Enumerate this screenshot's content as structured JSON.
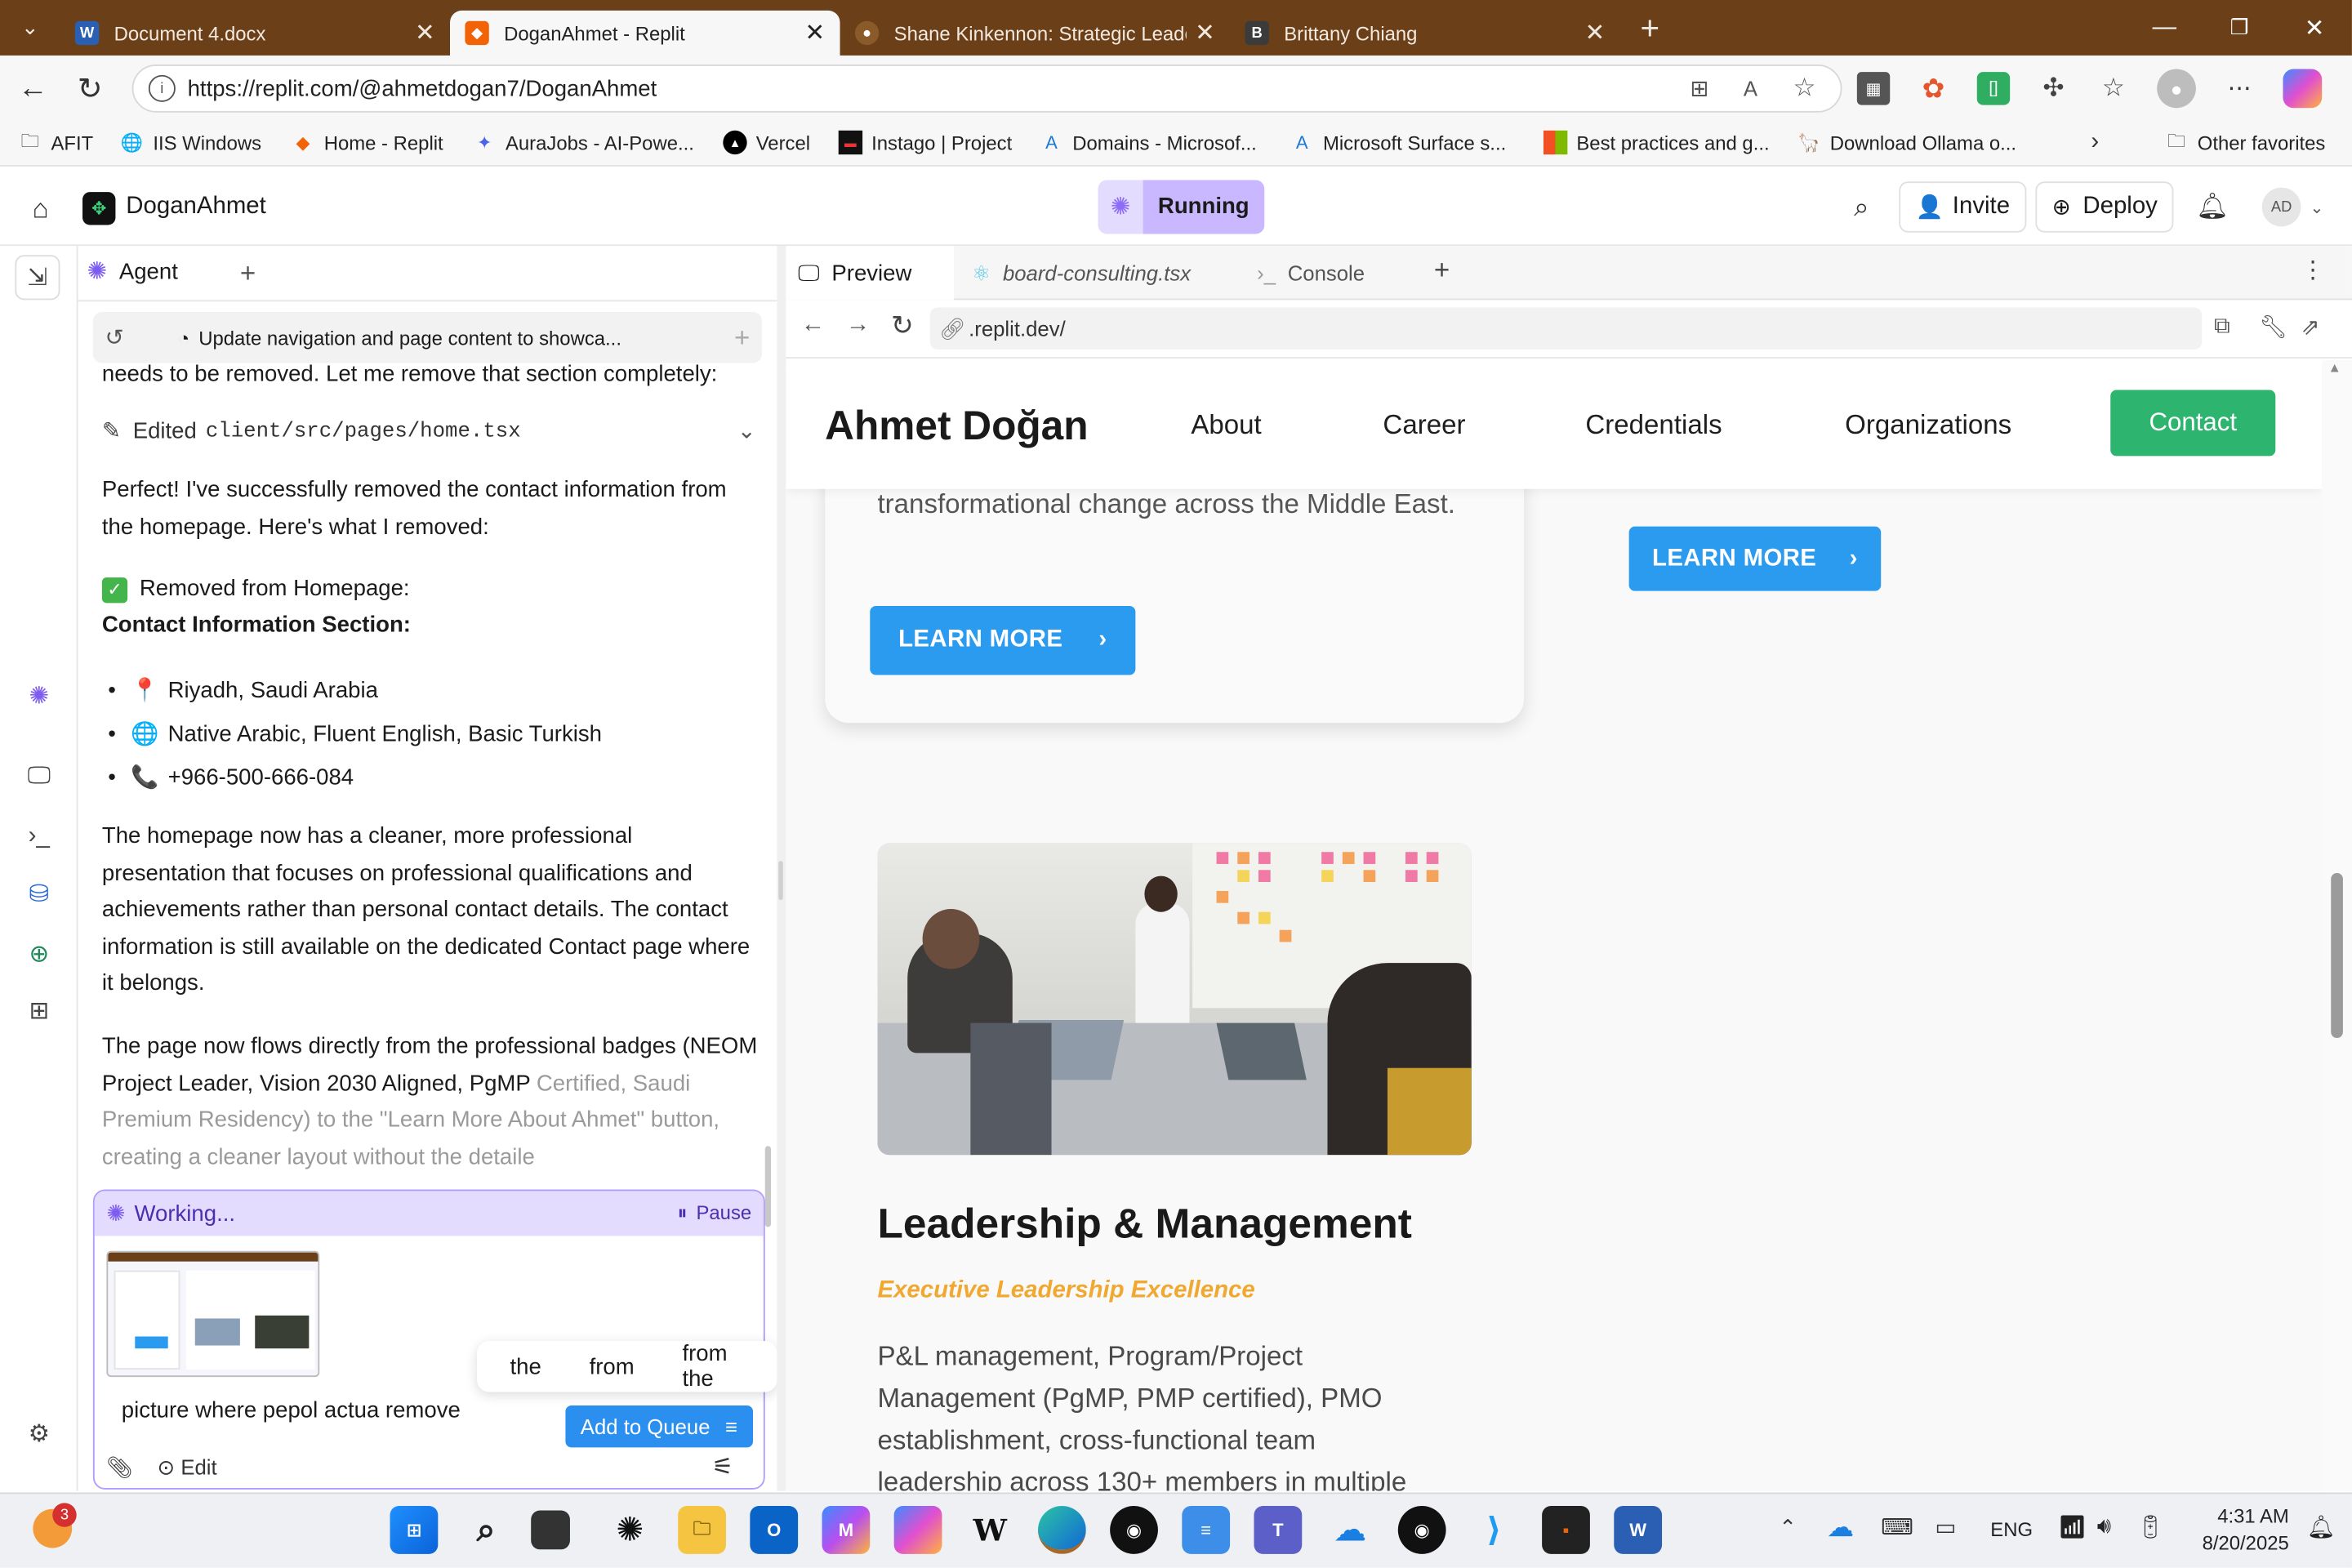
{
  "browser": {
    "tabs": [
      {
        "title": "Document 4.docx",
        "icon": "word-icon"
      },
      {
        "title": "DoganAhmet - Replit",
        "icon": "replit-icon"
      },
      {
        "title": "Shane Kinkennon: Strategic Leade",
        "icon": "site-icon"
      },
      {
        "title": "Brittany Chiang",
        "icon": "b-icon"
      }
    ],
    "url": "https://replit.com/@ahmetdogan7/DoganAhmet",
    "bookmarks": [
      "AFIT",
      "IIS Windows",
      "Home - Replit",
      "AuraJobs - AI-Powe...",
      "Vercel",
      "Instago | Project",
      "Domains - Microsof...",
      "Microsoft Surface s...",
      "Best practices and g...",
      "Download Ollama o..."
    ],
    "other_favorites": "Other favorites"
  },
  "replit": {
    "project_name": "DoganAhmet",
    "status": "Running",
    "invite": "Invite",
    "deploy": "Deploy",
    "avatar": "AD"
  },
  "agent": {
    "tab_label": "Agent",
    "checkpoint": "Update navigation and page content to showca...",
    "intro_line": "needs to be removed. Let me remove that section completely:",
    "edited_label": "Edited",
    "edited_file": "client/src/pages/home.tsx",
    "para1": "Perfect! I've successfully removed the contact information from the homepage. Here's what I removed:",
    "removed_heading": "Removed from Homepage:",
    "section_heading": "Contact Information Section:",
    "bullets": [
      {
        "emoji": "📍",
        "text": "Riyadh, Saudi Arabia"
      },
      {
        "emoji": "🌐",
        "text": "Native Arabic, Fluent English, Basic Turkish"
      },
      {
        "emoji": "📞",
        "text": "+966-500-666-084"
      }
    ],
    "para2": "The homepage now has a cleaner, more professional presentation that focuses on professional qualifications and achievements rather than personal contact details. The contact information is still available on the dedicated Contact page where it belongs.",
    "para3_a": "The page now flows directly from the professional badges (NEOM Project Leader, Vision 2030 Aligned, PgMP ",
    "para3_b": "Certified, Saudi Premium Residency) to the \"Learn More About Ahmet\" button, creating a cleaner layout without the detaile",
    "working": "Working...",
    "pause": "Pause",
    "input_text": "picture where pepol actua remove",
    "suggestions": [
      "the",
      "from",
      "from the"
    ],
    "edit": "Edit",
    "add_to_queue": "Add to Queue"
  },
  "preview": {
    "tabs": [
      "Preview",
      "board-consulting.tsx",
      "Console"
    ],
    "url": ".replit.dev/",
    "site": {
      "brand": "Ahmet Doğan",
      "nav": [
        "About",
        "Career",
        "Credentials",
        "Organizations"
      ],
      "contact": "Contact",
      "card_text": "transformational change across the Middle East.",
      "learn_more": "LEARN MORE",
      "section_title": "Leadership & Management",
      "section_subtitle": "Executive Leadership Excellence",
      "section_body": "P&L management, Program/Project Management (PgMP, PMP certified), PMO establishment, cross-functional team leadership across 130+ members in multiple"
    }
  },
  "taskbar": {
    "badge": "3",
    "lang": "ENG",
    "time": "4:31 AM",
    "date": "8/20/2025"
  },
  "colors": {
    "titlebar": "#6b3f17",
    "accent_purple": "#c9b8ff",
    "contact_green": "#2db46e",
    "learn_blue": "#2b9bf0",
    "subtitle_orange": "#f0a830"
  }
}
